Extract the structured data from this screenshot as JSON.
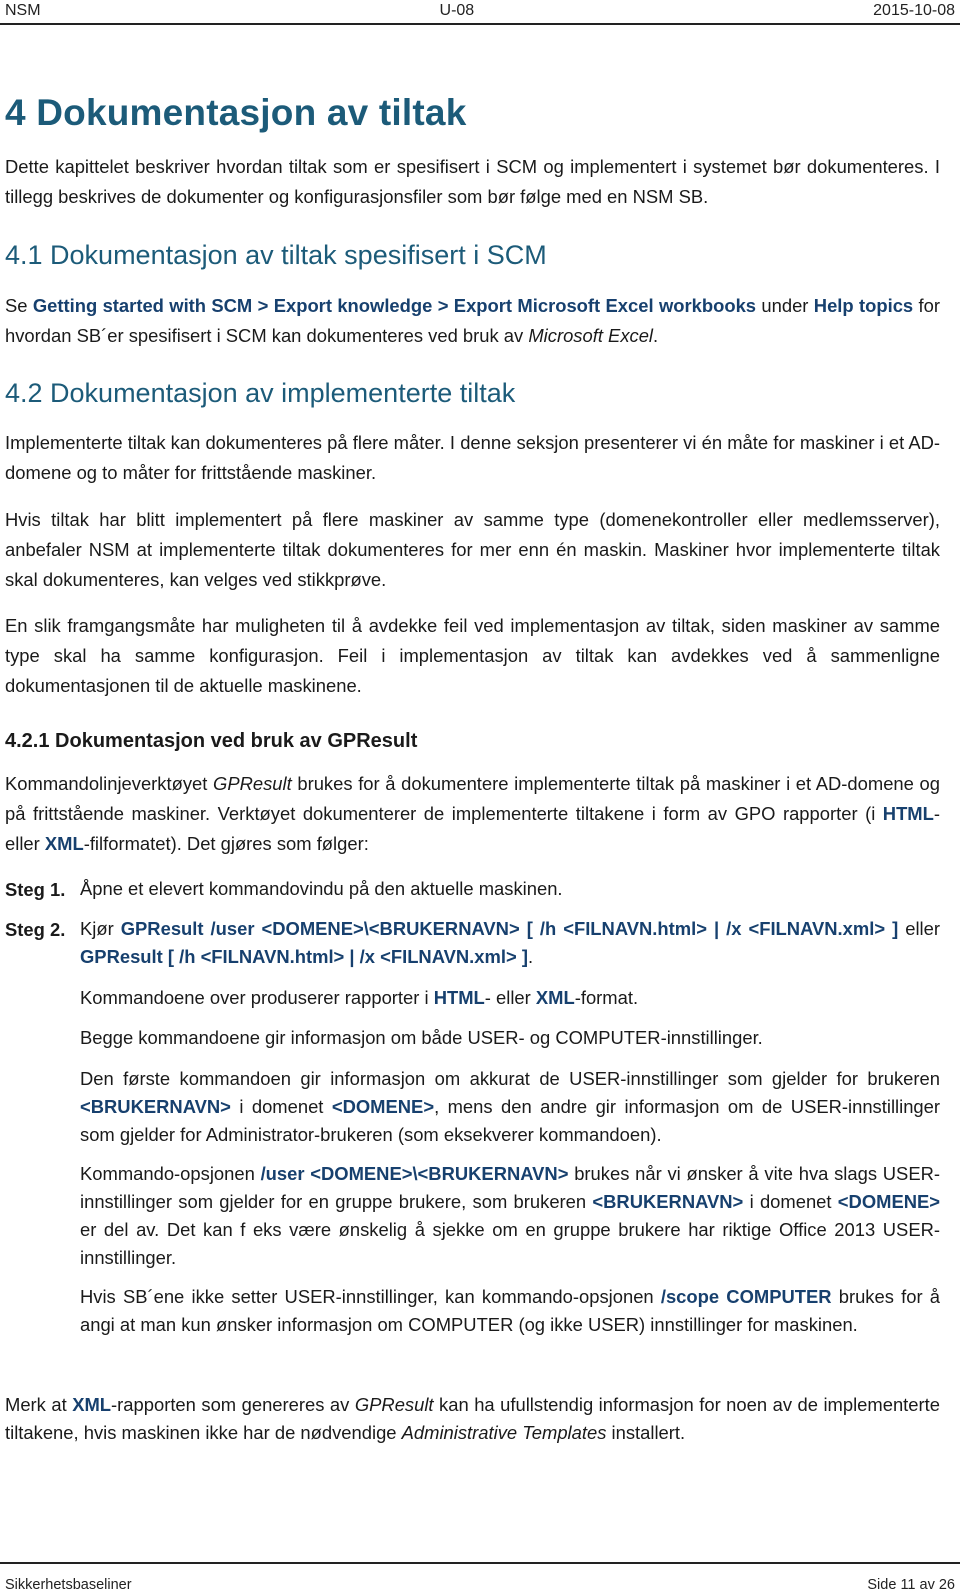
{
  "header": {
    "left": "NSM",
    "center": "U-08",
    "right": "2015-10-08"
  },
  "chapter": {
    "title": "4 Dokumentasjon av tiltak",
    "intro": "Dette kapittelet beskriver hvordan tiltak som er spesifisert i SCM og implementert i systemet bør dokumenteres. I tillegg beskrives de dokumenter og konfigurasjonsfiler som bør følge med en NSM SB."
  },
  "section_4_1": {
    "title": "4.1 Dokumentasjon av tiltak spesifisert i SCM",
    "p1": {
      "a": "Se ",
      "path": "Getting started with SCM > Export knowledge > Export Microsoft Excel workbooks",
      "b": " under ",
      "help": "Help topics",
      "c": " for hvordan SB´er spesifisert i SCM kan dokumenteres ved bruk av ",
      "excel": "Microsoft Excel",
      "d": "."
    }
  },
  "section_4_2": {
    "title": "4.2 Dokumentasjon av implementerte tiltak",
    "p1": "Implementerte tiltak kan dokumenteres på flere måter. I denne seksjon presenterer vi én måte for maskiner i et AD-domene og to måter for frittstående maskiner.",
    "p2": "Hvis tiltak har blitt implementert på flere maskiner av samme type (domenekontroller eller medlemsserver), anbefaler NSM at implementerte tiltak dokumenteres for mer enn én maskin. Maskiner hvor implementerte tiltak skal dokumenteres, kan velges ved stikkprøve.",
    "p3": "En slik framgangsmåte har muligheten til å avdekke feil ved implementasjon av tiltak, siden maskiner av samme type skal ha samme konfigurasjon. Feil i implementasjon av tiltak kan avdekkes ved å sammenligne dokumentasjonen til de aktuelle maskinene."
  },
  "section_4_2_1": {
    "title": "4.2.1 Dokumentasjon ved bruk av GPResult",
    "intro": {
      "a": "Kommandolinjeverktøyet ",
      "tool": "GPResult",
      "b": " brukes for å dokumentere implementerte tiltak på maskiner i et AD-domene og på frittstående maskiner. Verktøyet dokumenterer de implementerte tiltakene i form av GPO rapporter (i ",
      "html": "HTML",
      "c": "- eller ",
      "xml": "XML",
      "d": "-filformatet). Det gjøres som følger:"
    },
    "steps": [
      {
        "label": "Steg 1.",
        "text": "Åpne et elevert kommandovindu på den aktuelle maskinen."
      },
      {
        "label": "Steg 2.",
        "a": "Kjør ",
        "cmd1": "GPResult /user <DOMENE>\\<BRUKERNAVN> [ /h <FILNAVN.html> | /x <FILNAVN.xml> ]",
        "b": " eller ",
        "cmd2": "GPResult [ /h <FILNAVN.html> | /x <FILNAVN.xml> ]",
        "c": "."
      }
    ],
    "notes": {
      "n1": {
        "a": "Kommandoene over produserer rapporter i ",
        "html": "HTML",
        "b": "- eller ",
        "xml": "XML",
        "c": "-format."
      },
      "n2": "Begge kommandoene gir informasjon om både USER- og COMPUTER-innstillinger.",
      "n3": {
        "a": "Den første kommandoen gir informasjon om akkurat de USER-innstillinger som gjelder for brukeren ",
        "user": "<BRUKERNAVN>",
        "b": " i domenet ",
        "domain": "<DOMENE>",
        "c": ", mens den andre gir informasjon om de USER-innstillinger som gjelder for Administrator-brukeren (som eksekverer kommandoen)."
      },
      "n4": {
        "a": "Kommando-opsjonen ",
        "opt": "/user <DOMENE>\\<BRUKERNAVN>",
        "b": " brukes når vi ønsker å vite hva slags USER-innstillinger som gjelder for en gruppe brukere, som brukeren ",
        "user": "<BRUKERNAVN>",
        "c": " i domenet ",
        "domain": "<DOMENE>",
        "d": " er del av. Det kan f eks være ønskelig å sjekke om en gruppe brukere har riktige Office 2013 USER-innstillinger."
      },
      "n5": {
        "a": "Hvis SB´ene ikke setter USER-innstillinger, kan kommando-opsjonen ",
        "opt": "/scope COMPUTER",
        "b": " brukes for å angi at man kun ønsker informasjon om COMPUTER (og ikke USER) innstillinger for maskinen."
      }
    },
    "closing": {
      "a": "Merk at ",
      "xml": "XML",
      "b": "-rapporten som genereres av ",
      "tool": "GPResult",
      "c": " kan ha ufullstendig informasjon for noen av de implementerte tiltakene, hvis maskinen ikke har de nødvendige ",
      "templates": "Administrative Templates",
      "d": " installert."
    }
  },
  "footer": {
    "left": "Sikkerhetsbaseliner",
    "right": "Side 11 av 26"
  }
}
